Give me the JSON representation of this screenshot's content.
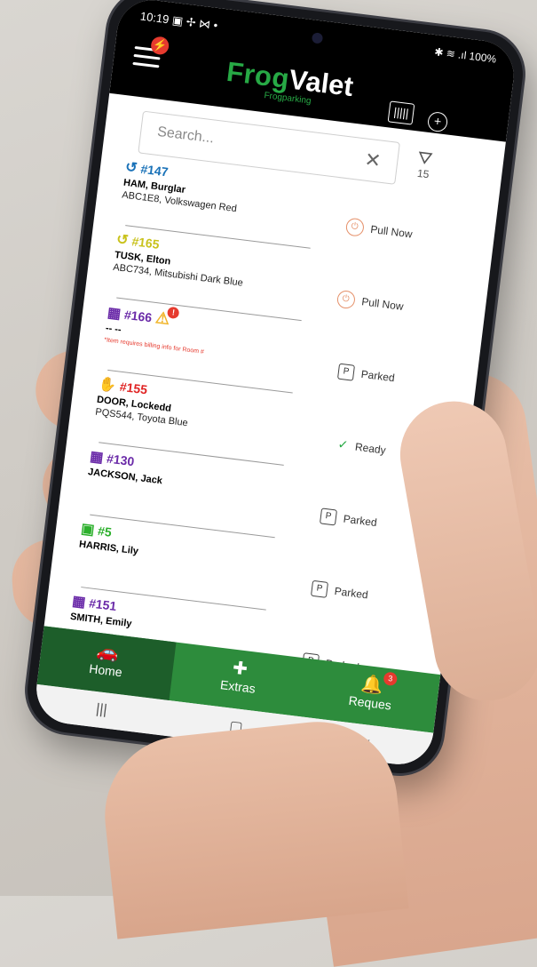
{
  "status_bar": {
    "time": "10:19",
    "left_icons": "▣ ✢ ⋈ •",
    "right": "✱ ≋ .ıl 100%"
  },
  "header": {
    "logo_frog": "Frog",
    "logo_valet": "Valet",
    "logo_sub": "Frogparking",
    "menu_badge": "⚡",
    "barcode_icon": "|||||",
    "add_icon": "+"
  },
  "search": {
    "placeholder": "Search...",
    "clear_icon": "✕"
  },
  "filter": {
    "icon": "⛛",
    "count": "15"
  },
  "items": [
    {
      "num": "#147",
      "color": "#1a72b8",
      "icon": "↺",
      "name": "HAM, Burglar",
      "detail": "ABC1E8, Volkswagen Red",
      "status": "Pull Now",
      "status_type": "pull"
    },
    {
      "num": "#165",
      "color": "#c9c21c",
      "icon": "↺",
      "name": "TUSK, Elton",
      "detail": "ABC734, Mitsubishi Dark Blue",
      "status": "Pull Now",
      "status_type": "pull"
    },
    {
      "num": "#166",
      "color": "#6a2aa8",
      "icon": "▦",
      "name": "-- --",
      "detail": "",
      "warning": "*Item requires billing info for Room #",
      "status": "Parked",
      "status_type": "parked",
      "alert_badge": "!"
    },
    {
      "num": "#155",
      "color": "#e02424",
      "icon": "✋",
      "name": "DOOR, Lockedd",
      "detail": "PQS544, Toyota Blue",
      "status": "Ready",
      "status_type": "ready"
    },
    {
      "num": "#130",
      "color": "#6a2aa8",
      "icon": "▦",
      "name": "JACKSON, Jack",
      "detail": "",
      "status": "Parked",
      "status_type": "parked"
    },
    {
      "num": "#5",
      "color": "#2cb02c",
      "icon": "▣",
      "name": "HARRIS, Lily",
      "detail": "",
      "status": "Parked",
      "status_type": "parked"
    },
    {
      "num": "#151",
      "color": "#6a2aa8",
      "icon": "▦",
      "name": "SMITH, Emily",
      "detail": "",
      "status": "Parked",
      "status_type": "parked"
    }
  ],
  "bottom_nav": {
    "home": "Home",
    "extras": "Extras",
    "requests": "Reques",
    "requests_badge": "3",
    "home_icon": "🚗",
    "extras_icon": "✚",
    "requests_icon": "🔔"
  },
  "system_nav": {
    "recents": "|||",
    "home": "▢",
    "back": "‹"
  }
}
